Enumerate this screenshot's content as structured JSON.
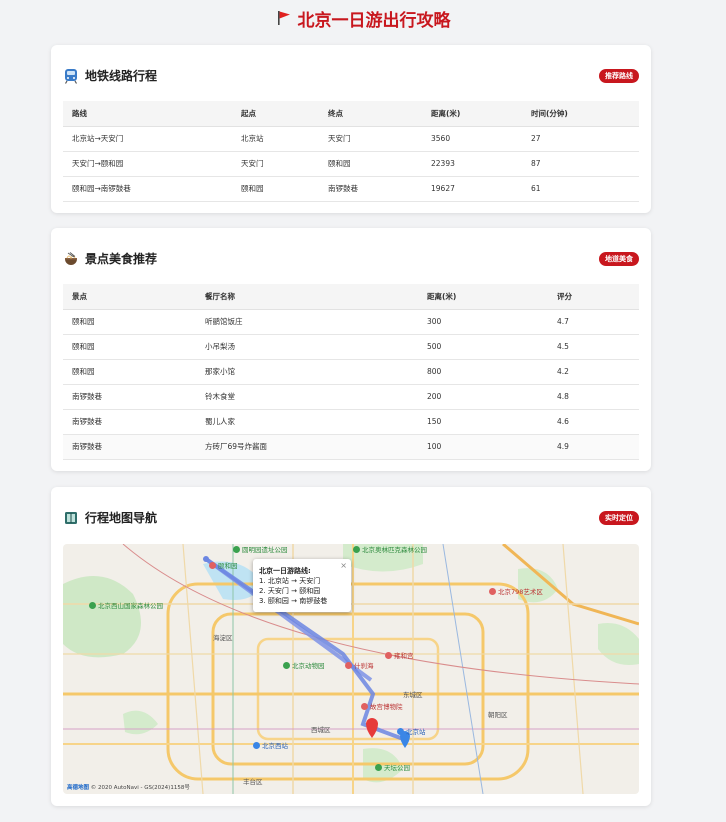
{
  "page": {
    "title": "北京一日游出行攻略"
  },
  "metro": {
    "title": "地铁线路行程",
    "badge": "推荐路线",
    "columns": [
      "路线",
      "起点",
      "终点",
      "距离(米)",
      "时间(分钟)"
    ],
    "rows": [
      [
        "北京站→天安门",
        "北京站",
        "天安门",
        "3560",
        "27"
      ],
      [
        "天安门→颐和园",
        "天安门",
        "颐和园",
        "22393",
        "87"
      ],
      [
        "颐和园→南锣鼓巷",
        "颐和园",
        "南锣鼓巷",
        "19627",
        "61"
      ]
    ]
  },
  "food": {
    "title": "景点美食推荐",
    "badge": "地道美食",
    "columns": [
      "景点",
      "餐厅名称",
      "距离(米)",
      "评分"
    ],
    "rows": [
      [
        "颐和园",
        "听鹂馆饭庄",
        "300",
        "4.7"
      ],
      [
        "颐和园",
        "小吊梨汤",
        "500",
        "4.5"
      ],
      [
        "颐和园",
        "那家小馆",
        "800",
        "4.2"
      ],
      [
        "南锣鼓巷",
        "铃木食堂",
        "200",
        "4.8"
      ],
      [
        "南锣鼓巷",
        "蜀儿人家",
        "150",
        "4.6"
      ],
      [
        "南锣鼓巷",
        "方砖厂69号炸酱面",
        "100",
        "4.9"
      ]
    ]
  },
  "map": {
    "title": "行程地图导航",
    "badge": "实时定位",
    "popup": {
      "title": "北京一日游路线:",
      "lines": [
        "1. 北京站 → 天安门",
        "2. 天安门 → 颐和园",
        "3. 颐和园 → 南锣鼓巷"
      ],
      "close": "×"
    },
    "copyright_logo": "高德地图",
    "copyright_text": "© 2020 AutoNavi - GS(2024)1158号",
    "pois": {
      "yiheyuan": "颐和园",
      "yuanmingyuan": "圆明园遗址公园",
      "beijing_tiyu": "北京奥林匹克森林公园",
      "xishan": "北京西山国家森林公园",
      "zoo": "北京动物园",
      "shichahai": "什刹海",
      "yonghegong": "雍和宫",
      "gugong": "故宫博物院",
      "beijingzhan": "北京站",
      "beijingxizhan": "北京西站",
      "tiantan": "天坛公园",
      "art798": "北京798艺术区",
      "chaoyang": "朝阳区",
      "haidian": "海淀区",
      "fengtai": "丰台区",
      "dongcheng": "东城区",
      "xicheng": "西城区"
    }
  }
}
